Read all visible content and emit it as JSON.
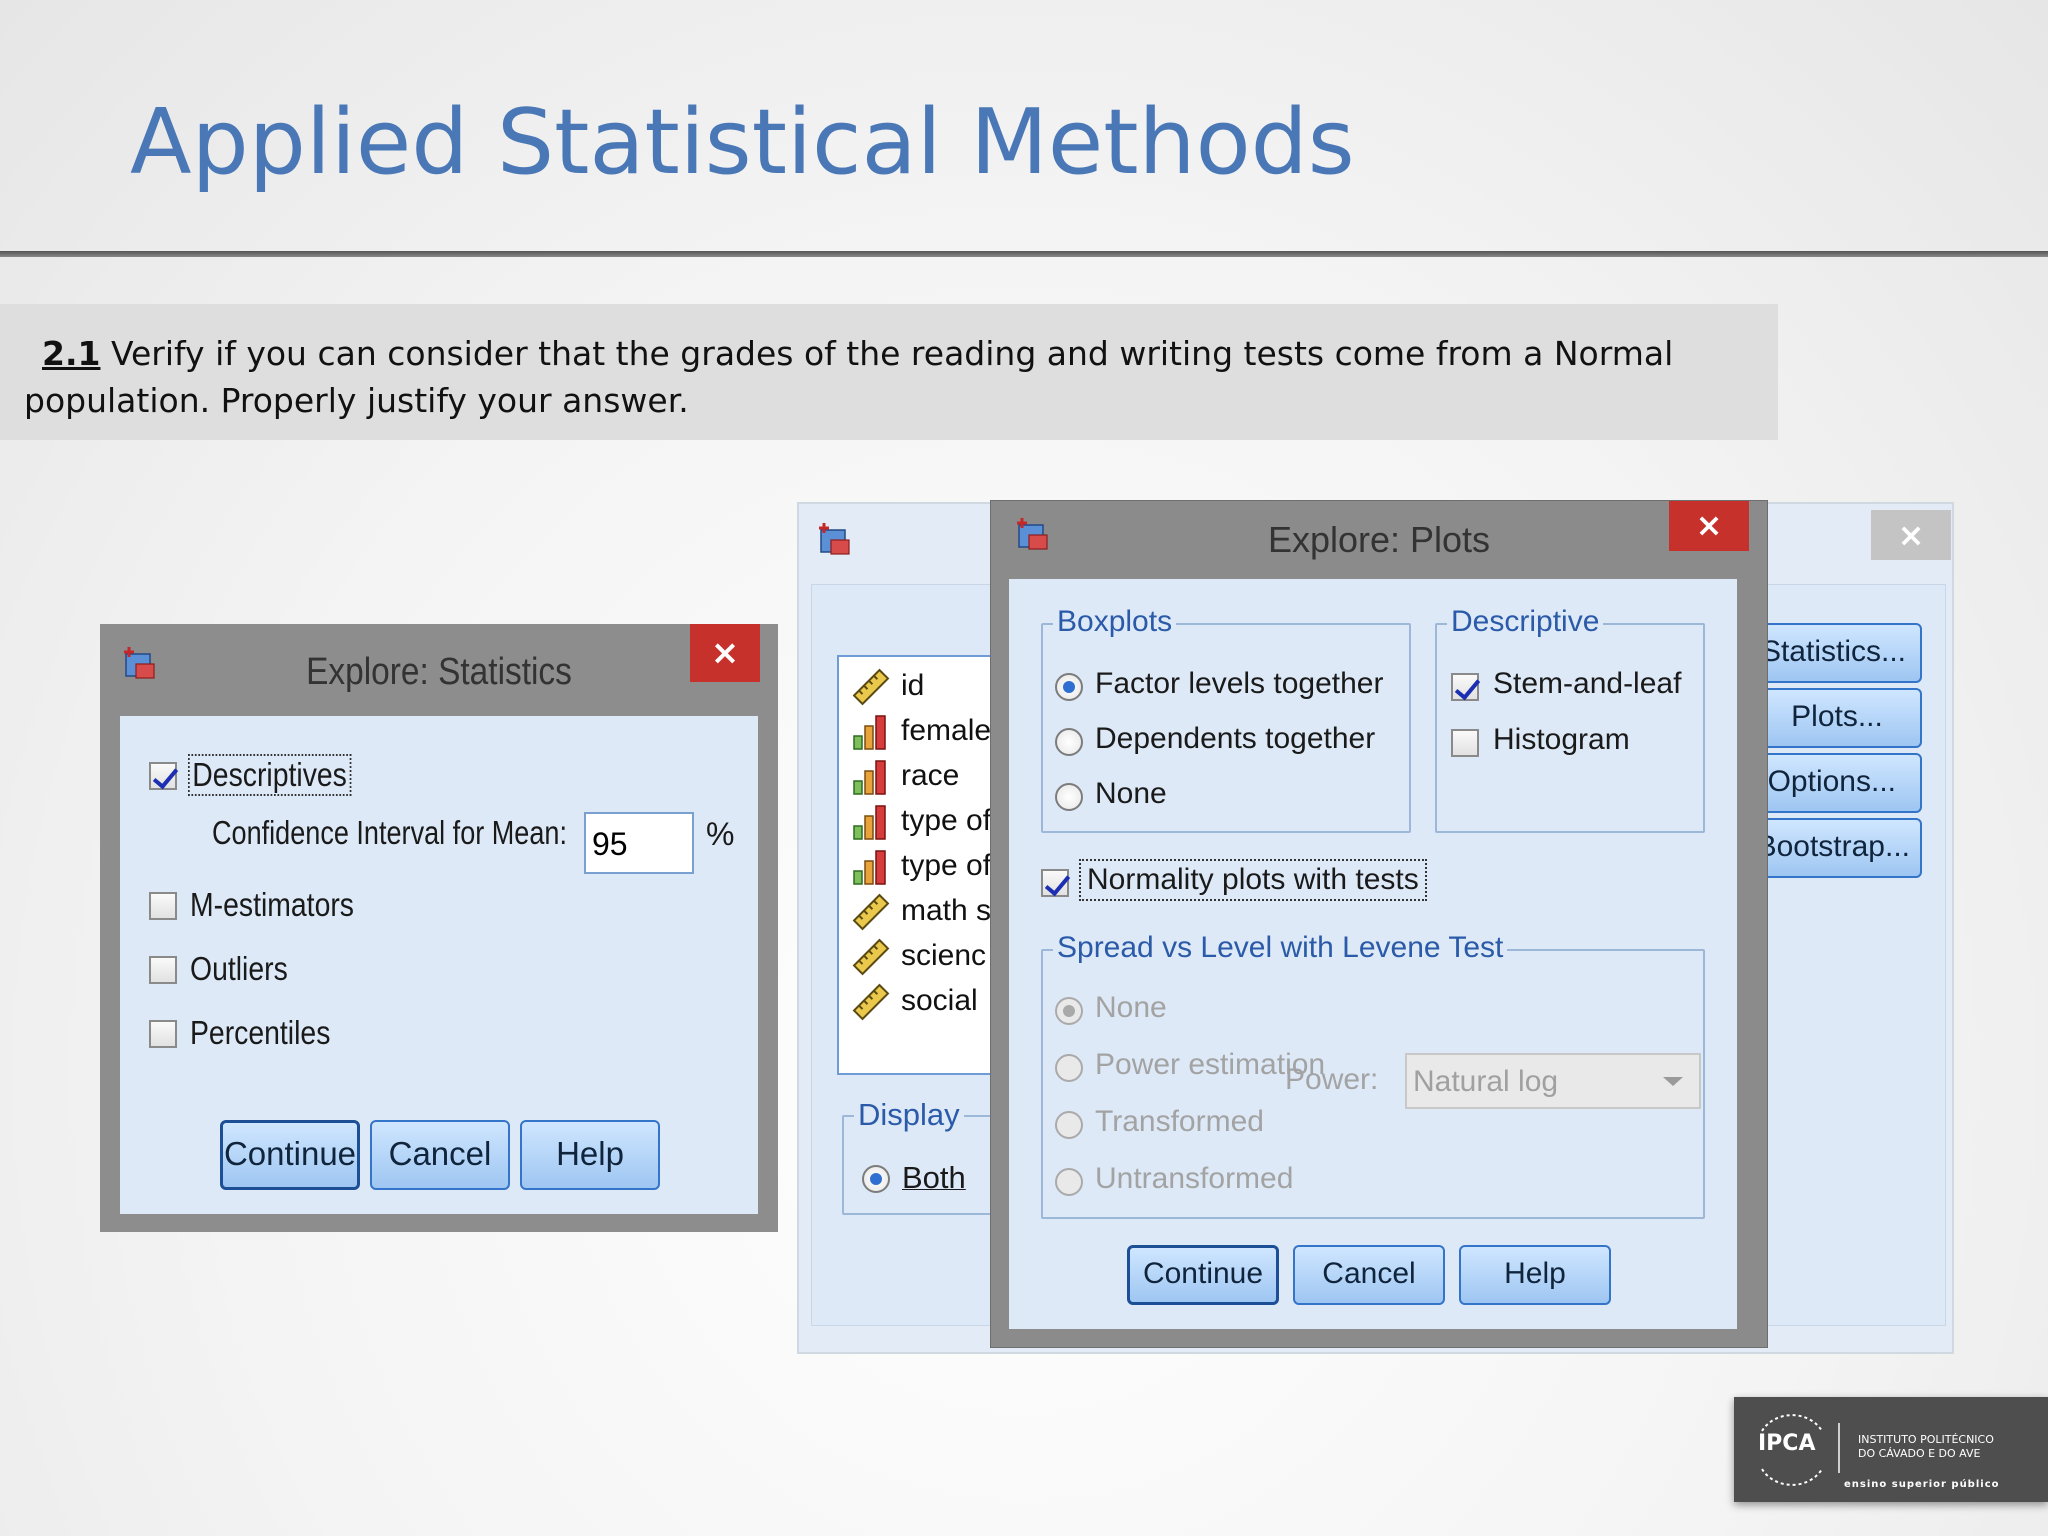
{
  "slide": {
    "title": "Applied Statistical Methods",
    "task_number": "2.1",
    "task_text_line1": " Verify if you can consider that the grades of the reading and writing tests come from a Normal",
    "task_text_line2": "population. Properly justify your answer."
  },
  "stats_dialog": {
    "title": "Explore: Statistics",
    "close_label": "×",
    "descriptives_label": "Descriptives",
    "descriptives_checked": true,
    "ci_label": "Confidence Interval for Mean:",
    "ci_value": "95",
    "ci_unit": "%",
    "m_estimators_label": "M-estimators",
    "outliers_label": "Outliers",
    "percentiles_label": "Percentiles",
    "continue_label": "Continue",
    "cancel_label": "Cancel",
    "help_label": "Help"
  },
  "explore_dialog": {
    "close_label": "×",
    "variables": [
      {
        "name": "id",
        "icon": "ruler-icon"
      },
      {
        "name": "female",
        "icon": "bar-chart-icon"
      },
      {
        "name": "race",
        "icon": "bar-chart-icon"
      },
      {
        "name": "type of",
        "icon": "bar-chart-icon"
      },
      {
        "name": "type of",
        "icon": "bar-chart-icon"
      },
      {
        "name": "math s",
        "icon": "ruler-icon"
      },
      {
        "name": "scienc",
        "icon": "ruler-icon"
      },
      {
        "name": "social",
        "icon": "ruler-icon"
      }
    ],
    "display_label": "Display",
    "display_both_label": "Both",
    "side_buttons": {
      "statistics": "Statistics...",
      "plots": "Plots...",
      "options": "Options...",
      "bootstrap": "Bootstrap..."
    }
  },
  "plots_dialog": {
    "title": "Explore: Plots",
    "close_label": "×",
    "boxplots_caption": "Boxplots",
    "boxplot_options": [
      "Factor levels together",
      "Dependents together",
      "None"
    ],
    "boxplot_selected": 0,
    "descriptive_caption": "Descriptive",
    "stem_leaf_label": "Stem-and-leaf",
    "stem_leaf_checked": true,
    "histogram_label": "Histogram",
    "histogram_checked": false,
    "normality_label": "Normality plots with tests",
    "normality_checked": true,
    "spread_caption": "Spread vs Level with Levene Test",
    "spread_options": [
      "None",
      "Power estimation",
      "Transformed",
      "Untransformed"
    ],
    "spread_selected": 0,
    "power_label": "Power:",
    "power_value": "Natural log",
    "continue_label": "Continue",
    "cancel_label": "Cancel",
    "help_label": "Help"
  },
  "logo": {
    "abbr": "IPCA",
    "line1": "INSTITUTO POLITÉCNICO",
    "line2": "DO CÁVADO E DO AVE",
    "line3": "ensino superior público"
  },
  "colors": {
    "title": "#4a78b6",
    "close_button": "#c7312b",
    "dialog_panel": "#dde9f7",
    "button_border": "#3474c9"
  }
}
